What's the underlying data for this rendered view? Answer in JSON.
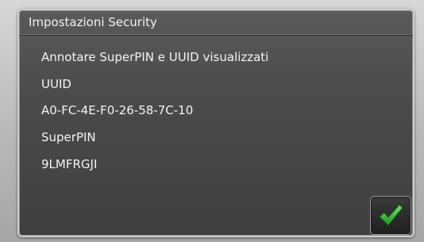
{
  "dialog": {
    "title": "Impostazioni Security",
    "lines": [
      "Annotare SuperPIN e UUID visualizzati",
      "UUID",
      "A0-FC-4E-F0-26-58-7C-10",
      "SuperPIN",
      "9LMFRGJI"
    ],
    "confirm_icon": "checkmark-icon",
    "accent_color": "#2fb52f"
  }
}
